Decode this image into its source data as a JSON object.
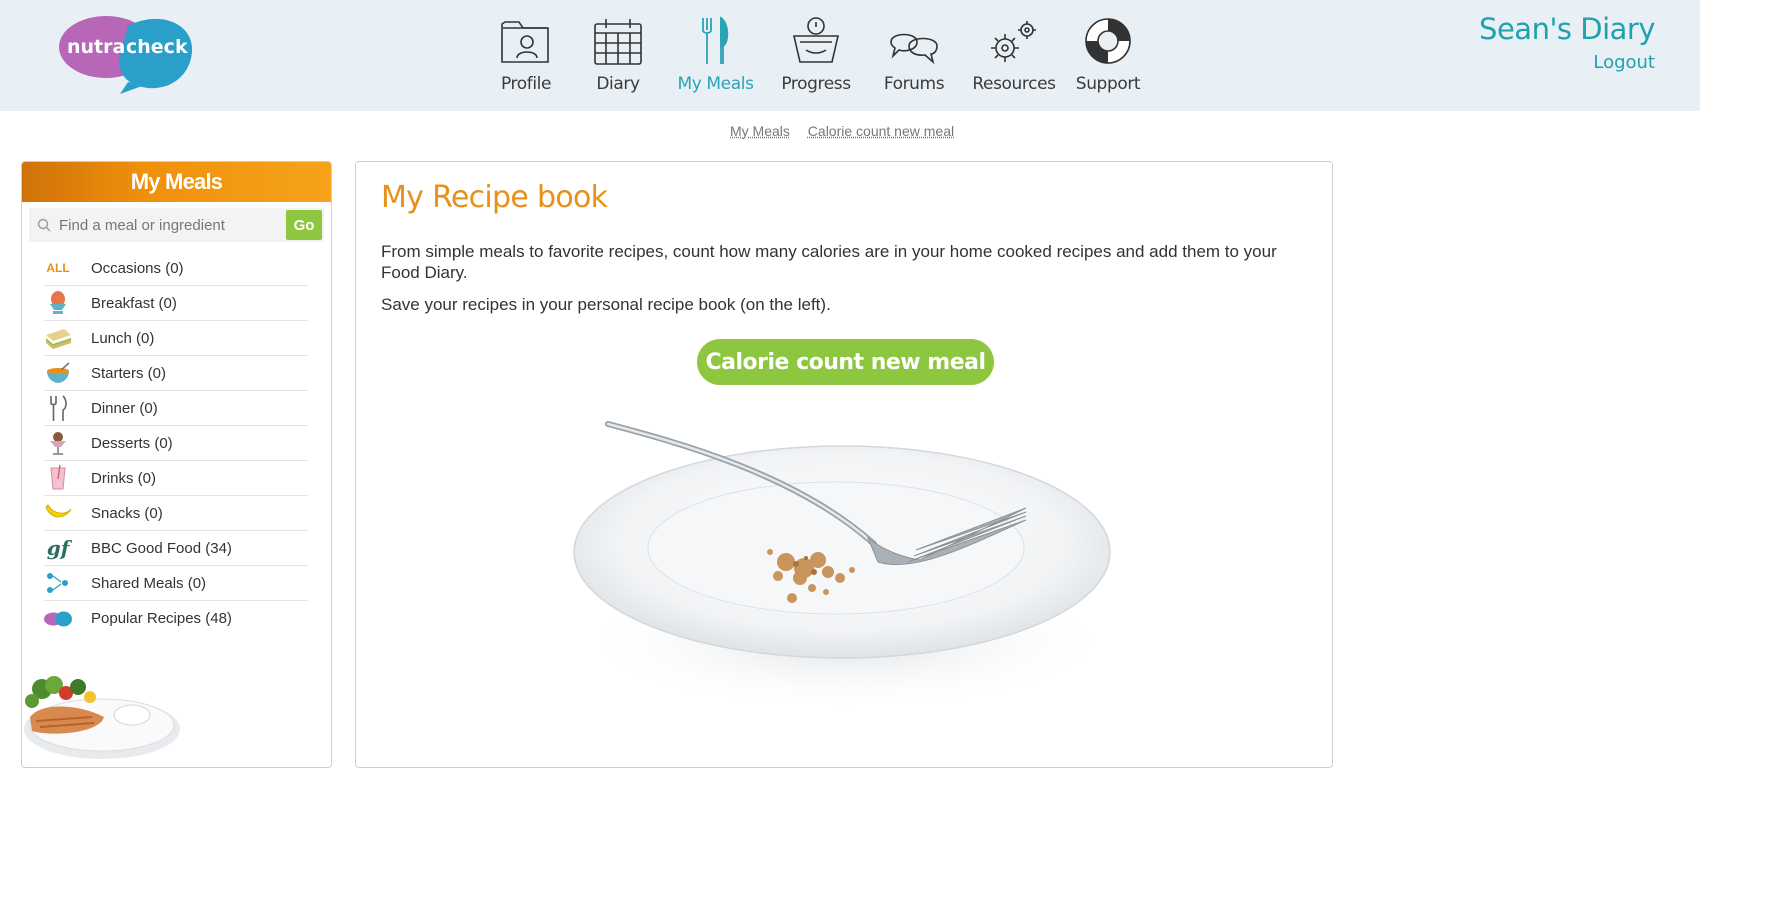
{
  "brand": {
    "logo_left": "nutra",
    "logo_right": "check"
  },
  "nav": {
    "items": [
      {
        "label": "Profile",
        "icon": "profile-icon"
      },
      {
        "label": "Diary",
        "icon": "calendar-icon"
      },
      {
        "label": "My Meals",
        "icon": "fork-knife-icon",
        "active": true
      },
      {
        "label": "Progress",
        "icon": "scale-icon"
      },
      {
        "label": "Forums",
        "icon": "speech-bubbles-icon"
      },
      {
        "label": "Resources",
        "icon": "gears-icon"
      },
      {
        "label": "Support",
        "icon": "lifebuoy-icon"
      }
    ]
  },
  "user": {
    "name": "Sean's Diary",
    "logout": "Logout"
  },
  "breadcrumb": [
    "My Meals",
    "Calorie count new meal"
  ],
  "sidebar": {
    "title": "My Meals",
    "search": {
      "placeholder": "Find a meal or ingredient",
      "button": "Go"
    },
    "items": [
      {
        "label": "Occasions (0)",
        "icon": "all-icon",
        "icon_text": "ALL"
      },
      {
        "label": "Breakfast (0)",
        "icon": "egg-cup-icon"
      },
      {
        "label": "Lunch (0)",
        "icon": "sandwich-icon"
      },
      {
        "label": "Starters (0)",
        "icon": "soup-bowl-icon"
      },
      {
        "label": "Dinner (0)",
        "icon": "fork-knife-icon"
      },
      {
        "label": "Desserts (0)",
        "icon": "sundae-icon"
      },
      {
        "label": "Drinks (0)",
        "icon": "drink-glass-icon"
      },
      {
        "label": "Snacks (0)",
        "icon": "banana-icon"
      },
      {
        "label": "BBC Good Food (34)",
        "icon": "good-food-icon",
        "icon_text": "gf"
      },
      {
        "label": "Shared Meals (0)",
        "icon": "shared-people-icon"
      },
      {
        "label": "Popular Recipes (48)",
        "icon": "nutracheck-mini-logo-icon"
      }
    ]
  },
  "main": {
    "title": "My Recipe book",
    "intro1": "From simple meals to favorite recipes, count how many calories are in your home cooked recipes and add them to your Food Diary.",
    "intro2": "Save your recipes in your personal recipe book (on the left).",
    "cta": "Calorie count new meal"
  },
  "colors": {
    "header_bg": "#e9f0f5",
    "accent_teal": "#1ea2ad",
    "accent_orange": "#e8901a",
    "accent_green": "#8dc63f",
    "logo_purple": "#b866b8",
    "logo_blue": "#2a9fc9"
  }
}
